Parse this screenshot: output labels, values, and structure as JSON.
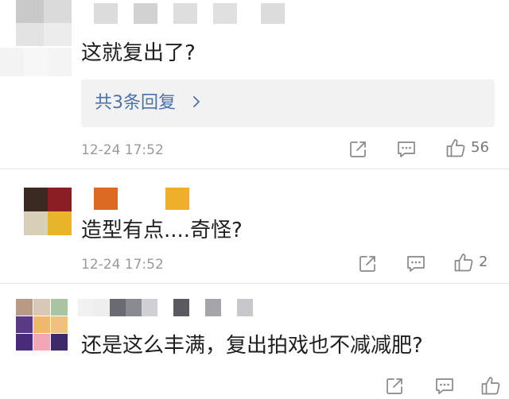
{
  "comments": [
    {
      "text": "这就复出了?",
      "replies_label": "共3条回复",
      "timestamp": "12-24 17:52",
      "likes": "56"
    },
    {
      "text": "造型有点....奇怪?",
      "timestamp": "12-24 17:52",
      "likes": "2"
    },
    {
      "text": "还是这么丰满，复出拍戏也不减减肥?"
    }
  ],
  "icons": {
    "share": "share-icon",
    "comment": "comment-icon",
    "like": "thumbs-up-icon",
    "replies_chevron": "chevron-right-icon"
  },
  "colors": {
    "link": "#4a72ad",
    "meta": "#9a9a9a",
    "reply_bg": "#f2f2f2"
  }
}
